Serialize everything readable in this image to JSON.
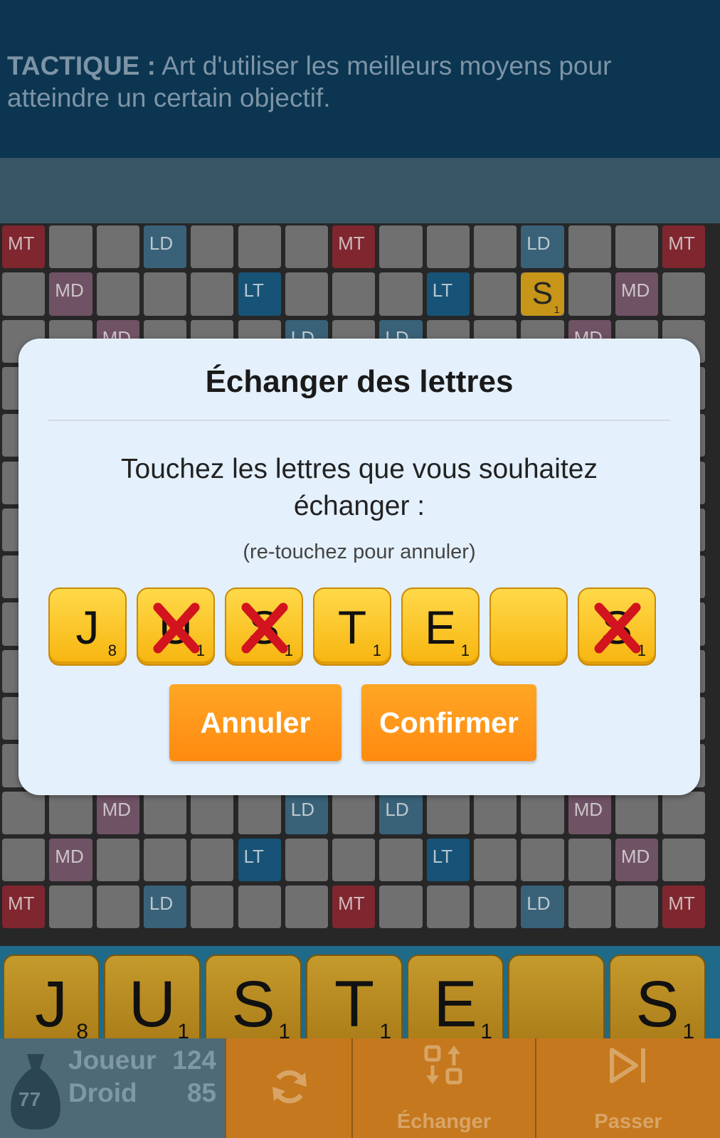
{
  "definition": {
    "term": "TACTIQUE :",
    "text": "Art d'utiliser les meilleurs moyens pour atteindre un certain objectif."
  },
  "board": {
    "premium_labels": {
      "mt": "MT",
      "md": "MD",
      "ld": "LD",
      "lt": "LT"
    },
    "visible_tiles": [
      {
        "letter": "S",
        "score": "1"
      }
    ]
  },
  "dialog": {
    "title": "Échanger des lettres",
    "instruction": "Touchez les lettres que vous souhaitez échanger :",
    "hint": "(re-touchez pour annuler)",
    "tiles": [
      {
        "letter": "J",
        "score": "8",
        "selected": false
      },
      {
        "letter": "U",
        "score": "1",
        "selected": true
      },
      {
        "letter": "S",
        "score": "1",
        "selected": true
      },
      {
        "letter": "T",
        "score": "1",
        "selected": false
      },
      {
        "letter": "E",
        "score": "1",
        "selected": false
      },
      {
        "letter": "",
        "score": "",
        "selected": false
      },
      {
        "letter": "S",
        "score": "1",
        "selected": true
      }
    ],
    "cancel_label": "Annuler",
    "confirm_label": "Confirmer"
  },
  "rack": {
    "tiles": [
      {
        "letter": "J",
        "score": "8"
      },
      {
        "letter": "U",
        "score": "1"
      },
      {
        "letter": "S",
        "score": "1"
      },
      {
        "letter": "T",
        "score": "1"
      },
      {
        "letter": "E",
        "score": "1"
      },
      {
        "letter": "",
        "score": ""
      },
      {
        "letter": "S",
        "score": "1"
      }
    ]
  },
  "scores": {
    "bag_count": "77",
    "players": [
      {
        "name": "Joueur",
        "score": "124"
      },
      {
        "name": "Droid",
        "score": "85"
      }
    ]
  },
  "actions": {
    "shuffle_icon": "shuffle-icon",
    "exchange_label": "Échanger",
    "pass_label": "Passer"
  },
  "colors": {
    "accent_orange": "#ff9a1a",
    "tile_yellow": "#f7c52a",
    "cross_red": "#d2141e",
    "banner_navy": "#0b3550"
  }
}
